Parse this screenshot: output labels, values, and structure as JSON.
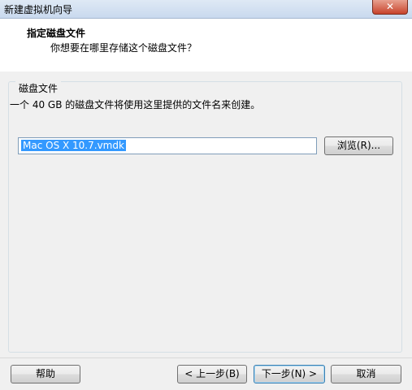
{
  "window": {
    "title": "新建虚拟机向导",
    "close_glyph": "✕"
  },
  "header": {
    "title": "指定磁盘文件",
    "subtitle": "你想要在哪里存储这个磁盘文件？"
  },
  "group": {
    "legend": "磁盘文件",
    "description": "一个 40 GB 的磁盘文件将使用这里提供的文件名来创建。"
  },
  "file_field": {
    "value": "Mac OS X 10.7.vmdk"
  },
  "buttons": {
    "browse": "浏览(R)...",
    "help": "帮助",
    "back": "< 上一步(B)",
    "next": "下一步(N) >",
    "cancel": "取消"
  },
  "colors": {
    "selection": "#3399ff",
    "close_button": "#c7432b",
    "titlebar": "#c9d9ee"
  }
}
